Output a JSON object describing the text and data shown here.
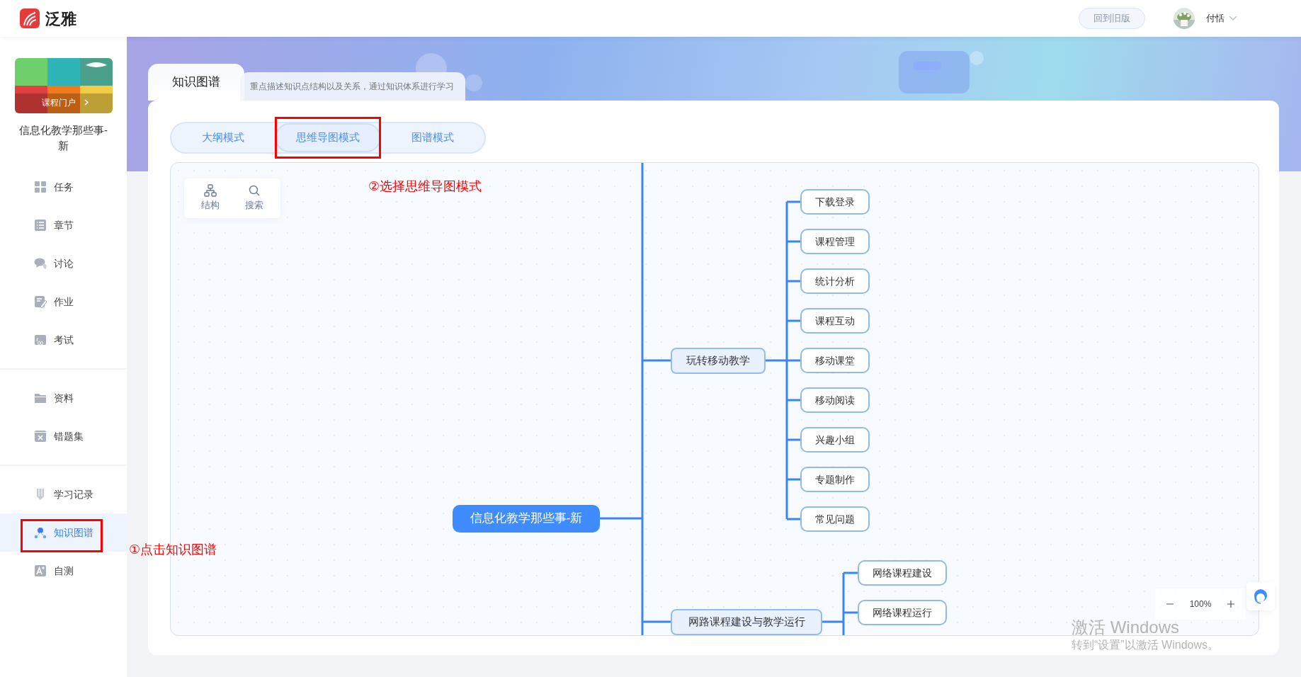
{
  "top_bar": {
    "brand": "泛雅",
    "old_version_button": "回到旧版",
    "user": {
      "name": "付恬"
    }
  },
  "sidebar": {
    "course": {
      "portal_label": "课程门户",
      "title": "信息化教学那些事-新"
    },
    "groups": [
      [
        {
          "label": "任务",
          "selected": false
        },
        {
          "label": "章节",
          "selected": false
        },
        {
          "label": "讨论",
          "selected": false
        },
        {
          "label": "作业",
          "selected": false
        },
        {
          "label": "考试",
          "selected": false
        }
      ],
      [
        {
          "label": "资料",
          "selected": false
        },
        {
          "label": "错题集",
          "selected": false
        }
      ],
      [
        {
          "label": "学习记录",
          "selected": false
        },
        {
          "label": "知识图谱",
          "selected": true
        },
        {
          "label": "自测",
          "selected": false
        }
      ]
    ]
  },
  "page_header": {
    "title": "知识图谱",
    "description": "重点描述知识点结构以及关系，通过知识体系进行学习"
  },
  "mode_tabs": [
    {
      "label": "大纲模式",
      "selected": false
    },
    {
      "label": "思维导图模式",
      "selected": true
    },
    {
      "label": "图谱模式",
      "selected": false
    }
  ],
  "toolbar": [
    {
      "label": "结构"
    },
    {
      "label": "搜索"
    }
  ],
  "mind_map": {
    "root": {
      "label": "信息化教学那些事-新",
      "children": [
        {
          "label": "玩转移动教学",
          "children": [
            {
              "label": "下载登录"
            },
            {
              "label": "课程管理"
            },
            {
              "label": "统计分析"
            },
            {
              "label": "课程互动"
            },
            {
              "label": "移动课堂"
            },
            {
              "label": "移动阅读"
            },
            {
              "label": "兴趣小组"
            },
            {
              "label": "专题制作"
            },
            {
              "label": "常见问题"
            }
          ]
        },
        {
          "label": "网路课程建设与教学运行",
          "children": [
            {
              "label": "网络课程建设"
            },
            {
              "label": "网络课程运行"
            }
          ]
        }
      ]
    }
  },
  "zoom": {
    "reading": "100%"
  },
  "annotations": [
    {
      "text": "①点击知识图谱"
    },
    {
      "text": "②选择思维导图模式"
    }
  ],
  "os_notice": {
    "title": "激活 Windows",
    "message": "转到“设置”以激活 Windows。"
  }
}
